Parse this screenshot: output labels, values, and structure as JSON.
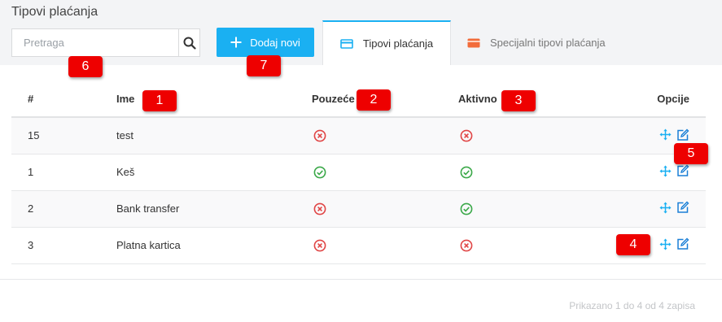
{
  "page": {
    "title": "Tipovi plaćanja"
  },
  "search": {
    "placeholder": "Pretraga"
  },
  "toolbar": {
    "add_label": "Dodaj novi"
  },
  "tabs": [
    {
      "label": "Tipovi plaćanja",
      "icon": "credit-card-icon",
      "active": true,
      "icon_color": "#1ab0f2"
    },
    {
      "label": "Specijalni tipovi plaćanja",
      "icon": "credit-card-icon",
      "active": false,
      "icon_color": "#f26b3a"
    }
  ],
  "table": {
    "headers": {
      "num": "#",
      "name": "Ime",
      "pouzece": "Pouzeće",
      "aktivno": "Aktivno",
      "opcije": "Opcije"
    },
    "rows": [
      {
        "num": "15",
        "name": "test",
        "pouzece": false,
        "aktivno": false
      },
      {
        "num": "1",
        "name": "Keš",
        "pouzece": true,
        "aktivno": true
      },
      {
        "num": "2",
        "name": "Bank transfer",
        "pouzece": false,
        "aktivno": true
      },
      {
        "num": "3",
        "name": "Platna kartica",
        "pouzece": false,
        "aktivno": false
      }
    ]
  },
  "footer": {
    "info": "Prikazano 1 do 4 od 4 zapisa"
  },
  "callouts": [
    "1",
    "2",
    "3",
    "4",
    "5",
    "6",
    "7"
  ],
  "colors": {
    "accent": "#1ab0f2",
    "yes": "#3aa848",
    "no": "#e04545",
    "callout": "#ee0000"
  }
}
